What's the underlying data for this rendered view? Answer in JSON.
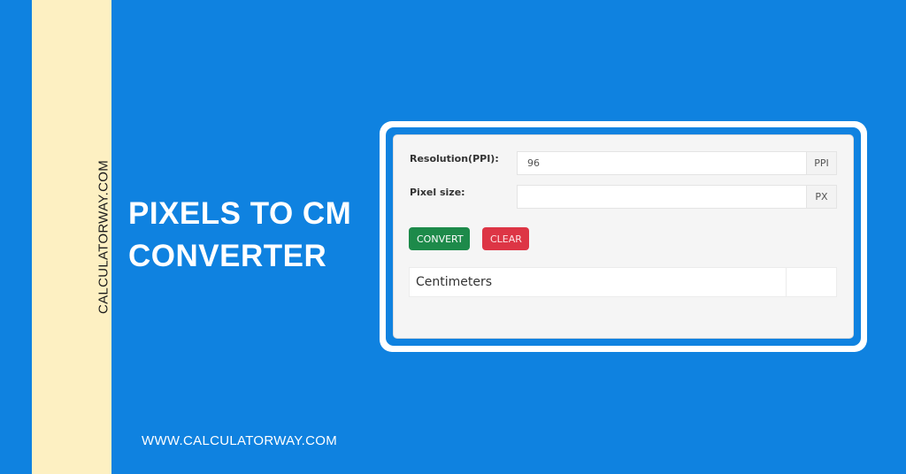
{
  "brand": {
    "vertical_site": "CALCULATORWAY.COM",
    "footer_url": "WWW.CALCULATORWAY.COM"
  },
  "headline": {
    "line1": "PIXELS TO CM",
    "line2": "CONVERTER"
  },
  "calculator": {
    "resolution": {
      "label": "Resolution(PPI):",
      "value": "96",
      "unit": "PPI"
    },
    "pixel_size": {
      "label": "Pixel size:",
      "value": "",
      "unit": "PX"
    },
    "buttons": {
      "convert": "CONVERT",
      "clear": "CLEAR"
    },
    "result": {
      "label": "Centimeters",
      "value": ""
    }
  },
  "colors": {
    "background": "#0f82e0",
    "stripe": "#fdf0c2",
    "convert": "#1d8a4a",
    "clear": "#dd3545"
  }
}
